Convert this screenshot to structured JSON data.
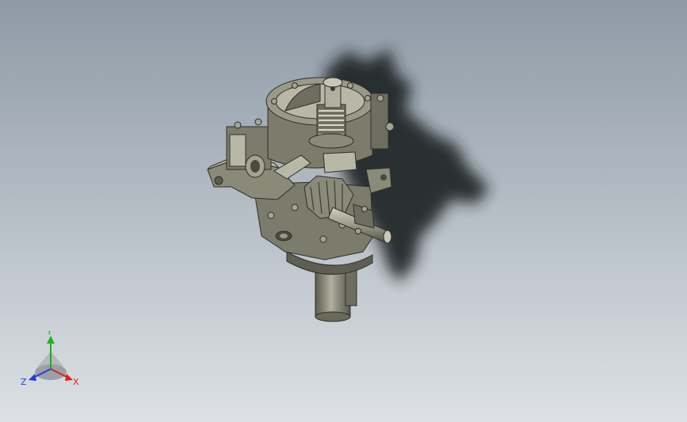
{
  "viewport": {
    "background_top": "#8e9aa6",
    "background_bottom": "#dde1e5",
    "shadow_color": "#1e2024"
  },
  "model": {
    "body_color": "#7c7c6c",
    "body_light": "#a4a492",
    "body_dark": "#4a4a40",
    "section_color": "#b8b8a6",
    "shaft_color": "#9a9a88"
  },
  "triad": {
    "x_label": "X",
    "y_label": "Y",
    "z_label": "Z",
    "x_color": "#e02020",
    "y_color": "#20b020",
    "z_color": "#2040d0"
  }
}
